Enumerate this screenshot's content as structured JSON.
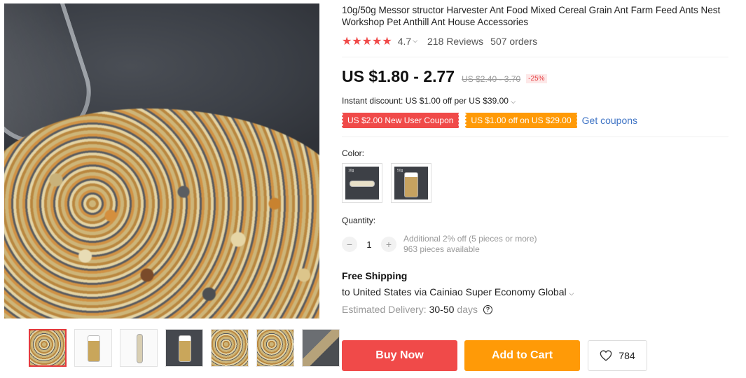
{
  "product": {
    "title": "10g/50g Messor structor Harvester Ant Food Mixed Cereal Grain Ant Farm Feed Ants Nest Workshop Pet Anthill Ant House Accessories",
    "rating": "4.7",
    "reviews": "218 Reviews",
    "orders": "507 orders"
  },
  "price": {
    "current": "US $1.80 - 2.77",
    "original": "US $2.40 - 3.70",
    "discount": "-25%"
  },
  "instant_discount": "Instant discount: US $1.00 off per US $39.00",
  "coupons": {
    "new_user": "US $2.00 New User Coupon",
    "off": "US $1.00 off on US $29.00",
    "get_link": "Get coupons"
  },
  "color": {
    "label": "Color:",
    "options": [
      {
        "label": "10g"
      },
      {
        "label": "50g"
      }
    ]
  },
  "quantity": {
    "label": "Quantity:",
    "value": "1",
    "note_line1": "Additional 2% off (5 pieces or more)",
    "note_line2": "963 pieces available"
  },
  "shipping": {
    "title": "Free Shipping",
    "to": "to United States via Cainiao Super Economy Global",
    "delivery_label": "Estimated Delivery:",
    "delivery_days": "30-50",
    "delivery_unit": "days"
  },
  "actions": {
    "buy_now": "Buy Now",
    "add_to_cart": "Add to Cart",
    "wishlist_count": "784"
  },
  "colors": {
    "accent_red": "#f04a49",
    "accent_orange": "#ff9a07",
    "link_blue": "#3f74c5"
  }
}
